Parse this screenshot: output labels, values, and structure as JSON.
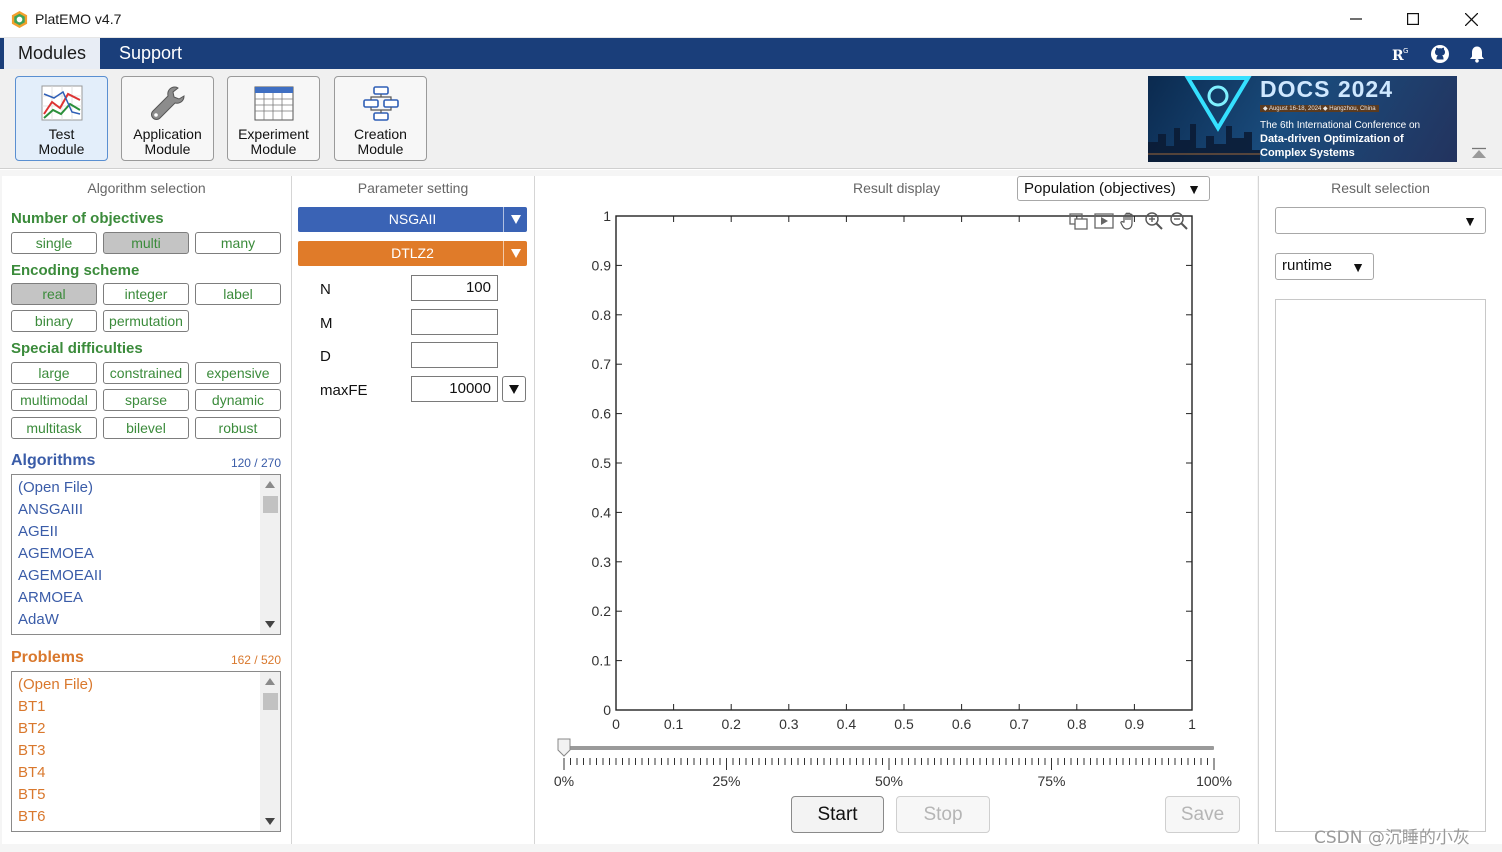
{
  "window": {
    "title": "PlatEMO v4.7"
  },
  "menu": {
    "modules": "Modules",
    "support": "Support"
  },
  "toolbar": {
    "buttons": [
      {
        "line1": "Test",
        "line2": "Module"
      },
      {
        "line1": "Application",
        "line2": "Module"
      },
      {
        "line1": "Experiment",
        "line2": "Module"
      },
      {
        "line1": "Creation",
        "line2": "Module"
      }
    ],
    "banner": {
      "title": "DOCS 2024",
      "dates": "◆ August 16-18, 2024   ◆ Hangzhou, China",
      "line1": "The 6th International Conference on",
      "line2": "Data-driven Optimization of",
      "line3": "Complex Systems"
    }
  },
  "algorithm_selection": {
    "title": "Algorithm selection",
    "objectives_title": "Number of objectives",
    "objectives": [
      "single",
      "multi",
      "many"
    ],
    "encoding_title": "Encoding scheme",
    "encoding": [
      "real",
      "integer",
      "label",
      "binary",
      "permutation"
    ],
    "difficulties_title": "Special difficulties",
    "difficulties": [
      "large",
      "constrained",
      "expensive",
      "multimodal",
      "sparse",
      "dynamic",
      "multitask",
      "bilevel",
      "robust"
    ],
    "algorithms_title": "Algorithms",
    "algorithms_count": "120 / 270",
    "algorithms": [
      "(Open File)",
      "ANSGAIII",
      "AGEII",
      "AGEMOEA",
      "AGEMOEAII",
      "ARMOEA",
      "AdaW"
    ],
    "problems_title": "Problems",
    "problems_count": "162 / 520",
    "problems": [
      "(Open File)",
      "BT1",
      "BT2",
      "BT3",
      "BT4",
      "BT5",
      "BT6"
    ]
  },
  "parameter_setting": {
    "title": "Parameter setting",
    "algorithm": "NSGAII",
    "problem": "DTLZ2",
    "params": [
      {
        "label": "N",
        "value": "100"
      },
      {
        "label": "M",
        "value": ""
      },
      {
        "label": "D",
        "value": ""
      },
      {
        "label": "maxFE",
        "value": "10000"
      }
    ]
  },
  "result_display": {
    "title": "Result display",
    "mode": "Population (objectives)",
    "y_ticks": [
      "0",
      "0.1",
      "0.2",
      "0.3",
      "0.4",
      "0.5",
      "0.6",
      "0.7",
      "0.8",
      "0.9",
      "1"
    ],
    "x_ticks": [
      "0",
      "0.1",
      "0.2",
      "0.3",
      "0.4",
      "0.5",
      "0.6",
      "0.7",
      "0.8",
      "0.9",
      "1"
    ],
    "progress_ticks": [
      "0%",
      "25%",
      "50%",
      "75%",
      "100%"
    ],
    "progress": 0,
    "start": "Start",
    "stop": "Stop",
    "save": "Save"
  },
  "result_selection": {
    "title": "Result selection",
    "selected": "",
    "metric": "runtime"
  },
  "watermark": "CSDN @沉睡的小灰",
  "colors": {
    "menubar": "#1a3e7a",
    "green": "#3b8b3b",
    "blue": "#3a5ca8",
    "orange": "#d9782d",
    "algo_dropdown": "#3a63b5",
    "problem_dropdown": "#e07b29"
  }
}
